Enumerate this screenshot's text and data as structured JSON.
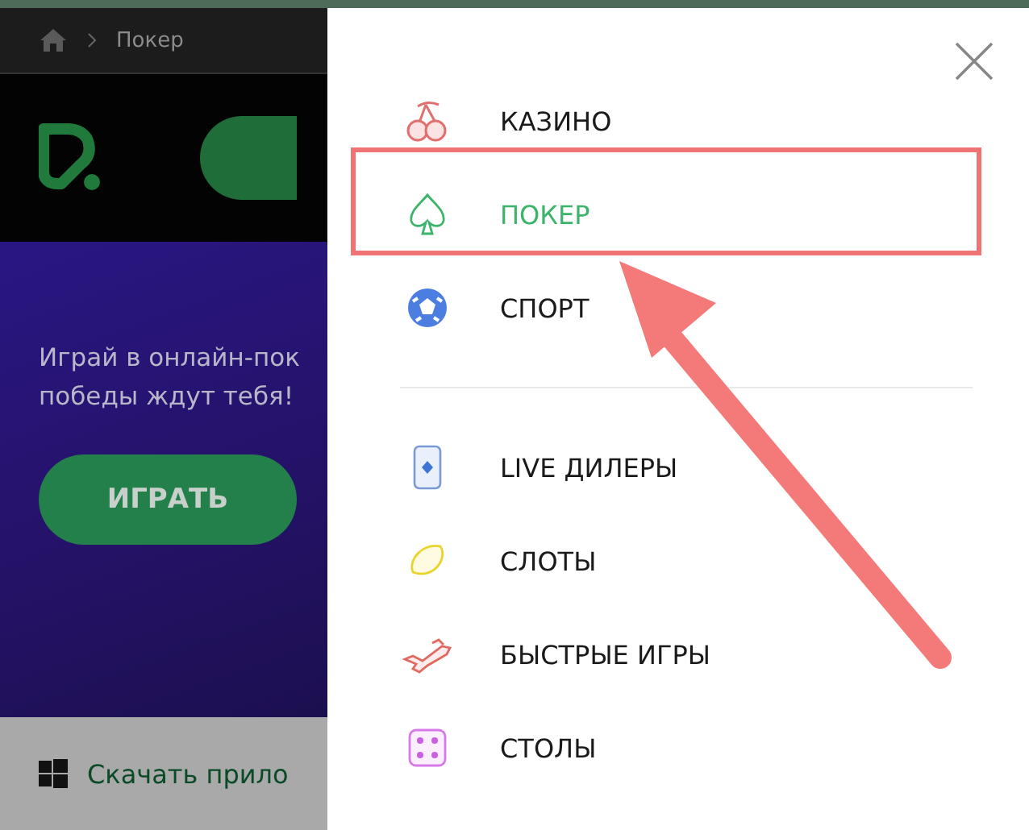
{
  "breadcrumb": {
    "page": "Покер"
  },
  "hero": {
    "lines": [
      "Играй в онлайн-пок",
      "победы ждут тебя!"
    ],
    "button": "ИГРАТЬ"
  },
  "download_bar": {
    "label": "Скачать прило"
  },
  "menu": {
    "groups": [
      [
        {
          "label": "КАЗИНО",
          "selected": false
        },
        {
          "label": "ПОКЕР",
          "selected": true
        },
        {
          "label": "СПОРТ",
          "selected": false
        }
      ],
      [
        {
          "label": "LIVE ДИЛЕРЫ",
          "selected": false
        },
        {
          "label": "СЛОТЫ",
          "selected": false
        },
        {
          "label": "БЫСТРЫЕ ИГРЫ",
          "selected": false
        },
        {
          "label": "СТОЛЫ",
          "selected": false
        }
      ]
    ]
  }
}
